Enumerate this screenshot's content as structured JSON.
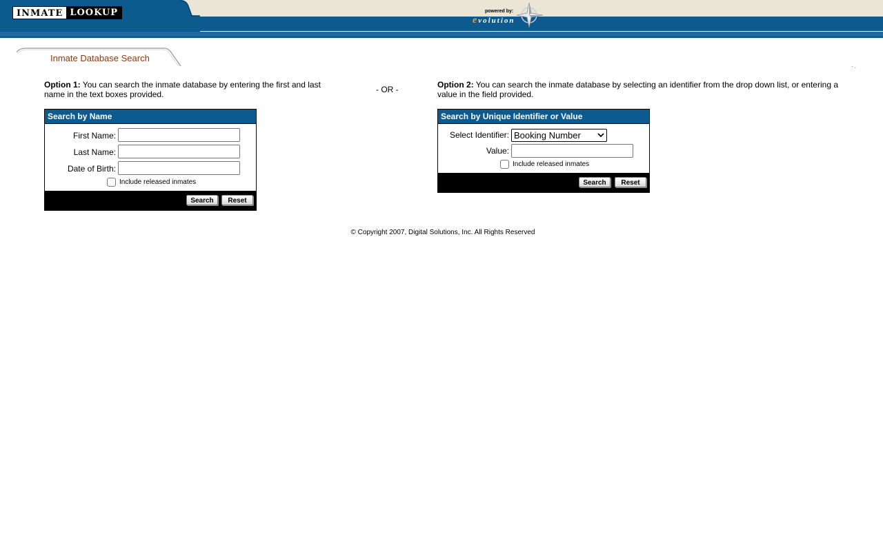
{
  "header": {
    "logo_word1": "INMATE",
    "logo_word2": "LOOKUP",
    "powered_by": "powered by:",
    "brand_e": "e",
    "brand_rest": "volution"
  },
  "page_tab": {
    "label": "Inmate Database Search"
  },
  "option1": {
    "label": "Option 1:",
    "text": " You can search the inmate database by entering the first and last name in the text boxes provided."
  },
  "separator": "- OR -",
  "option2": {
    "label": "Option 2:",
    "text": " You can search the inmate database by selecting an identifier from the drop down list, or entering a value in the field provided."
  },
  "search_by_name": {
    "title": "Search by Name",
    "first_name_label": "First Name:",
    "first_name_value": "",
    "last_name_label": "Last Name:",
    "last_name_value": "",
    "dob_label": "Date of Birth:",
    "dob_value": "",
    "include_released_label": "Include released inmates",
    "search_button": "Search",
    "reset_button": "Reset"
  },
  "search_by_identifier": {
    "title": "Search by Unique Identifier or Value",
    "identifier_label": "Select Identifier:",
    "identifier_selected": "Booking Number",
    "value_label": "Value:",
    "value_value": "",
    "include_released_label": "Include released inmates",
    "search_button": "Search",
    "reset_button": "Reset"
  },
  "footer": {
    "copyright": "© Copyright 2007, Digital Solutions, Inc. All Rights Reserved"
  },
  "colors": {
    "header_blue": "#0d5a8e",
    "header_beige": "#ebe5d6",
    "tab_label": "#8a3a0a",
    "panel_footer": "#000000"
  }
}
